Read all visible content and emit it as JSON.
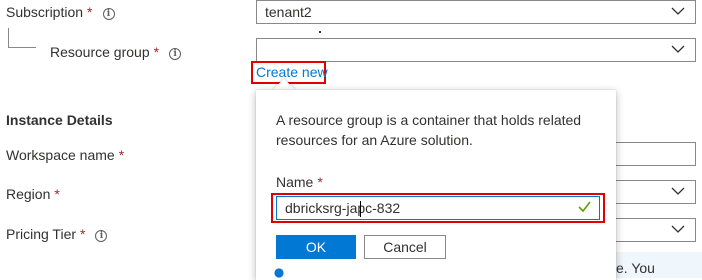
{
  "form": {
    "subscription_label": "Subscription",
    "subscription_value": "tenant2",
    "resource_group_label": "Resource group",
    "resource_group_value": "",
    "create_new_link": "Create new",
    "instance_details_title": "Instance Details",
    "workspace_name_label": "Workspace name",
    "region_label": "Region",
    "pricing_tier_label": "Pricing Tier",
    "required_mark": "*",
    "info_glyph": "i"
  },
  "callout": {
    "description": "A resource group is a container that holds related resources for an Azure solution.",
    "name_label": "Name",
    "name_required_mark": "*",
    "name_value": "dbricksrg-japc-832",
    "ok_label": "OK",
    "cancel_label": "Cancel"
  },
  "footer": {
    "partial_text": "e. You"
  },
  "colors": {
    "accent": "#0078d4",
    "highlight": "#e00000",
    "required": "#a4262c",
    "valid": "#57a300"
  },
  "icons": [
    "info-icon",
    "chevron-down-icon",
    "checkmark-icon",
    "info-circle-icon"
  ]
}
